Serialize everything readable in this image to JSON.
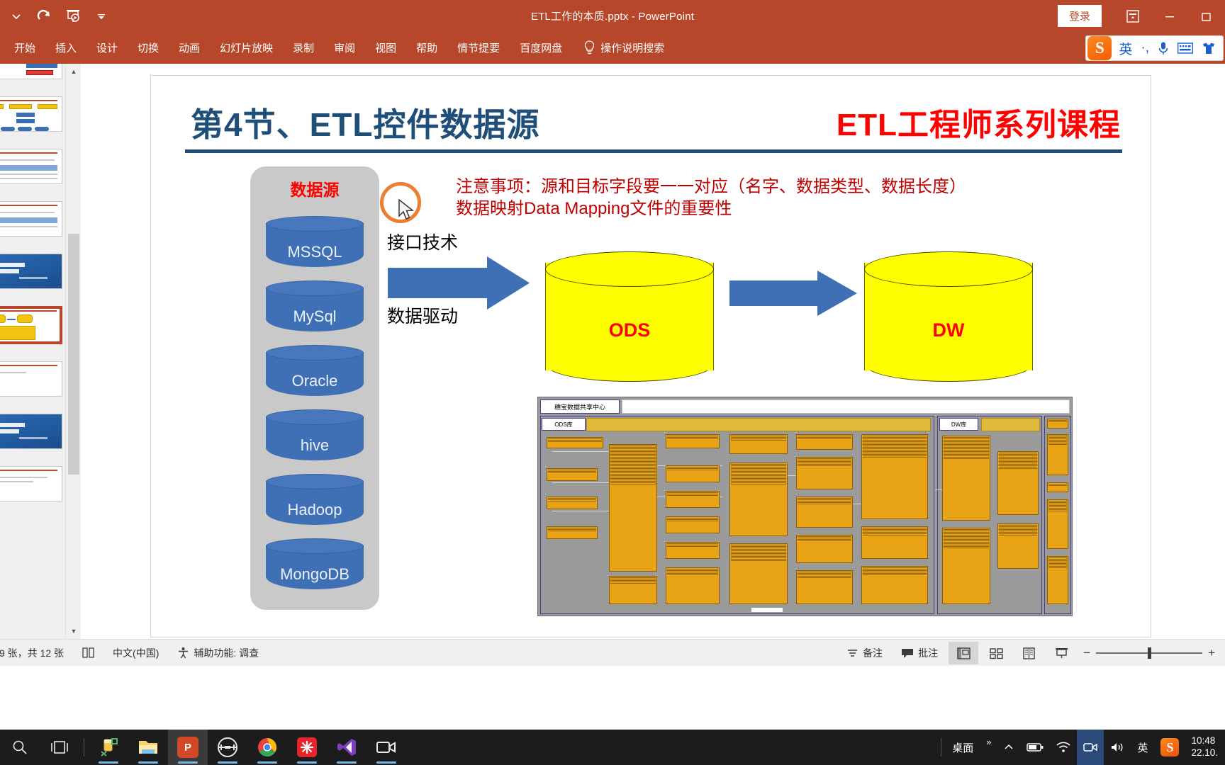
{
  "window": {
    "title": "ETL工作的本质.pptx  -  PowerPoint",
    "signin_label": "登录",
    "qat": [
      {
        "name": "qat-dropdown-icon",
        "glyph": "chevron"
      },
      {
        "name": "redo-icon",
        "glyph": "redo"
      },
      {
        "name": "start-presentation-icon",
        "glyph": "present"
      },
      {
        "name": "qat-more-icon",
        "glyph": "caret"
      }
    ],
    "caption_buttons": [
      {
        "name": "ribbon-display-options",
        "glyph": "ribbon"
      },
      {
        "name": "minimize",
        "glyph": "—"
      },
      {
        "name": "restore",
        "glyph": "restore"
      }
    ]
  },
  "ribbon": {
    "tabs": [
      "开始",
      "插入",
      "设计",
      "切换",
      "动画",
      "幻灯片放映",
      "录制",
      "审阅",
      "视图",
      "帮助",
      "情节提要",
      "百度网盘"
    ],
    "tell_me": "操作说明搜索"
  },
  "ime": {
    "logo": "S",
    "items": [
      "英",
      "·,",
      "mic",
      "keyboard",
      "skin"
    ]
  },
  "slide": {
    "title": "第4节、ETL控件数据源",
    "course": "ETL工程师系列课程",
    "note_line1": "注意事项：源和目标字段要一一对应（名字、数据类型、数据长度）",
    "note_line2": "数据映射Data Mapping文件的重要性",
    "datasource_title": "数据源",
    "databases": [
      "MSSQL",
      "MySql",
      "Oracle",
      "hive",
      "Hadoop",
      "MongoDB"
    ],
    "arrow_label_top": "接口技术",
    "arrow_label_bottom": "数据驱动",
    "ods_label": "ODS",
    "dw_label": "DW",
    "er_diagram": {
      "title": "穗宝数据共享中心",
      "ods_label": "ODS库",
      "dw_label": "DW库"
    },
    "colors": {
      "title_blue": "#1f4e79",
      "course_red": "#ff0000",
      "note_red": "#c00000",
      "cylinder_blue": "#3f6fb5",
      "cylinder_yellow": "#ffff00",
      "panel_gray": "#c9c9c9",
      "arrow_blue": "#3f6fb5",
      "highlight_orange": "#ed7d31"
    }
  },
  "thumbnails": {
    "count": 10,
    "selected_index": 5
  },
  "status": {
    "slide_counter": "9 张，共 12 张",
    "accessibility_icon": "accessibility-icon",
    "language": "中文(中国)",
    "accessibility": "辅助功能: 调查",
    "notes": "备注",
    "comments": "批注",
    "views": [
      "normal-view",
      "slide-sorter-view",
      "reading-view",
      "slideshow-view"
    ],
    "zoom_minus": "−",
    "zoom_plus": "+"
  },
  "taskbar": {
    "apps": [
      {
        "name": "search-icon",
        "label": ""
      },
      {
        "name": "task-view-icon",
        "label": ""
      },
      {
        "name": "snip-tool-icon",
        "label": ""
      },
      {
        "name": "file-explorer-icon",
        "label": ""
      },
      {
        "name": "powerpoint-icon",
        "label": "P"
      },
      {
        "name": "xmind-icon",
        "label": ""
      },
      {
        "name": "chrome-icon",
        "label": ""
      },
      {
        "name": "app-red-icon",
        "label": ""
      },
      {
        "name": "vscode-icon",
        "label": ""
      },
      {
        "name": "camera-recorder-icon",
        "label": ""
      }
    ],
    "tray": {
      "desktop": "桌面",
      "overflow": "»",
      "ime_label": "英",
      "sogou": "S",
      "time": "10:48",
      "date": "22.10."
    }
  }
}
